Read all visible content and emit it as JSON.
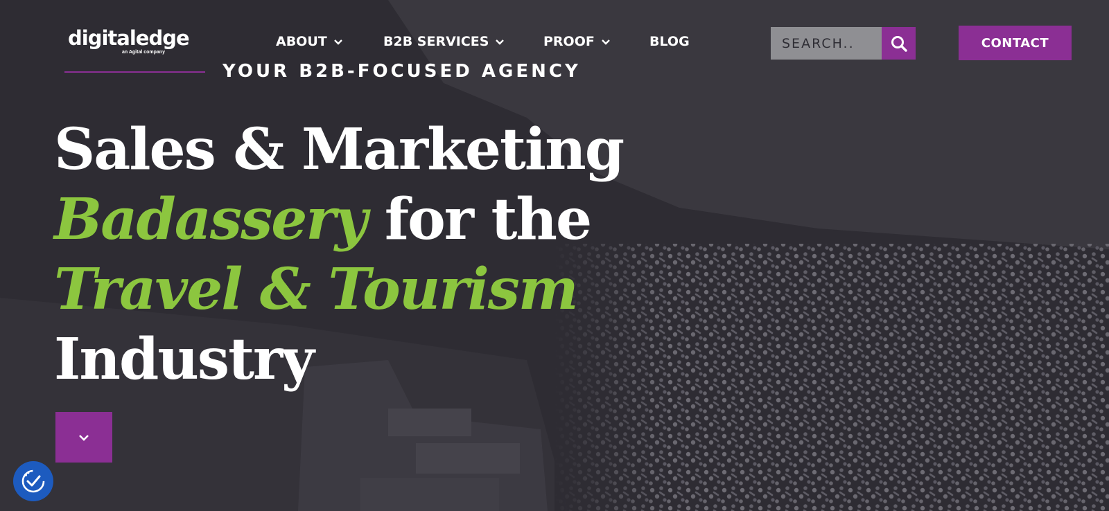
{
  "colors": {
    "accent_purple": "#8b2f94",
    "accent_green": "#8cc63f",
    "background": "#2e2c33",
    "accessibility_blue": "#1d5bbf"
  },
  "logo": {
    "name": "digitaledge",
    "sub": "an Agital company"
  },
  "nav": {
    "items": [
      {
        "label": "ABOUT",
        "dropdown": true
      },
      {
        "label": "B2B SERVICES",
        "dropdown": true
      },
      {
        "label": "PROOF",
        "dropdown": true
      },
      {
        "label": "BLOG",
        "dropdown": false
      }
    ]
  },
  "search": {
    "placeholder": "SEARCH..",
    "value": "",
    "icon": "search-icon"
  },
  "contact": {
    "label": "CONTACT"
  },
  "hero": {
    "tagline": "YOUR B2B-FOCUSED AGENCY",
    "line1": "Sales & Marketing",
    "line2_highlight": "Badassery",
    "line2_rest": " for the",
    "line3_highlight": "Travel & Tourism",
    "line4": "Industry",
    "scroll_icon": "chevron-down-icon"
  },
  "accessibility": {
    "icon": "accessibility-icon"
  }
}
